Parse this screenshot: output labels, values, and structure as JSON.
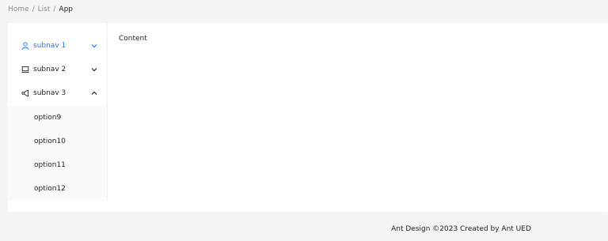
{
  "breadcrumb": {
    "items": [
      "Home",
      "List",
      "App"
    ],
    "separator": "/"
  },
  "sidebar": {
    "submenus": [
      {
        "label": "subnav 1",
        "icon": "user-icon",
        "arrow": "chevron-down-icon",
        "active": true
      },
      {
        "label": "subnav 2",
        "icon": "laptop-icon",
        "arrow": "chevron-down-icon",
        "active": false
      },
      {
        "label": "subnav 3",
        "icon": "notification-icon",
        "arrow": "chevron-up-icon",
        "active": false
      }
    ],
    "options": [
      "option9",
      "option10",
      "option11",
      "option12"
    ]
  },
  "content": {
    "text": "Content"
  },
  "footer": {
    "text": "Ant Design ©2023 Created by Ant UED"
  },
  "colors": {
    "primary": "#1677ff",
    "page_background": "#f5f5f5",
    "container_background": "#ffffff",
    "submenu_background": "#fafafa"
  }
}
